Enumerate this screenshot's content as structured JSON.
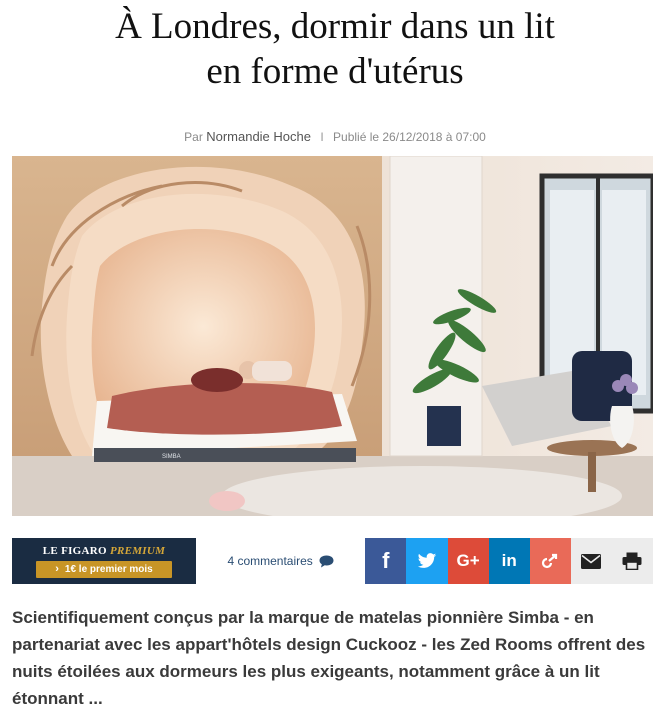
{
  "article": {
    "title_line1": "À Londres, dormir dans un lit",
    "title_line2": "en forme d'utérus",
    "byline_prefix": "Par",
    "author": "Normandie Hoche",
    "separator": "I",
    "published": "Publié le 26/12/2018 à 07:00",
    "lede": "Scientifiquement conçus par la marque de matelas pionnière Simba - en partenariat avec les appart'hôtels design Cuckooz - les Zed Rooms offrent des nuits étoilées aux dormeurs les plus exigeants, notamment grâce à un lit étonnant ..."
  },
  "photo": {
    "mattress_label": "SIMBA"
  },
  "premium": {
    "brand": "LE FIGARO",
    "brand_accent": "PREMIUM",
    "cta_chevron": "›",
    "cta": "1€ le premier mois"
  },
  "comments": {
    "label": "4 commentaires",
    "icon": "speech-bubble-icon"
  },
  "share": {
    "facebook": "f",
    "google": "G+",
    "linkedin": "in",
    "icons": [
      "facebook-icon",
      "twitter-icon",
      "google-plus-icon",
      "linkedin-icon",
      "share-icon",
      "mail-icon",
      "print-icon"
    ]
  },
  "colors": {
    "premium_bg": "#1a2c42",
    "premium_gold": "#c89526",
    "facebook": "#3b5998",
    "twitter": "#1da1f2",
    "google": "#dd4b39",
    "linkedin": "#0077b5",
    "share": "#e96a58",
    "link": "#2a4d73"
  }
}
